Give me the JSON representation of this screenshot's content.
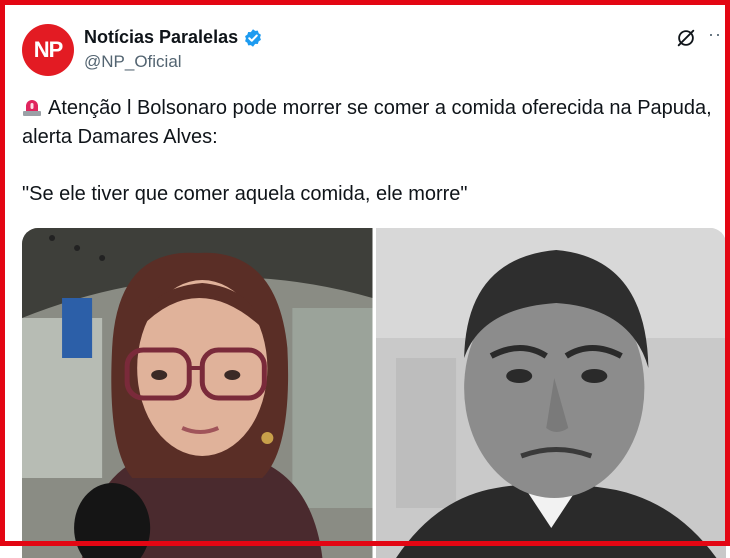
{
  "account": {
    "avatar_text": "NP",
    "display_name": "Notícias Paralelas",
    "handle": "@NP_Oficial",
    "verified": true
  },
  "tweet": {
    "emoji": "rotating-light-icon",
    "line1": "Atenção l Bolsonaro pode morrer se comer a comida oferecida na Papuda, alerta Damares Alves:",
    "quote": "\"Se ele tiver que comer aquela comida, ele morre\""
  },
  "colors": {
    "accent_red": "#e31b23",
    "frame_red": "#e30613",
    "verified_blue": "#1d9bf0",
    "text": "#0f1419",
    "secondary_text": "#536471"
  },
  "media": {
    "photos": [
      {
        "name": "photo-woman-with-glasses",
        "style": "color"
      },
      {
        "name": "photo-man-black-and-white",
        "style": "grayscale"
      }
    ]
  }
}
